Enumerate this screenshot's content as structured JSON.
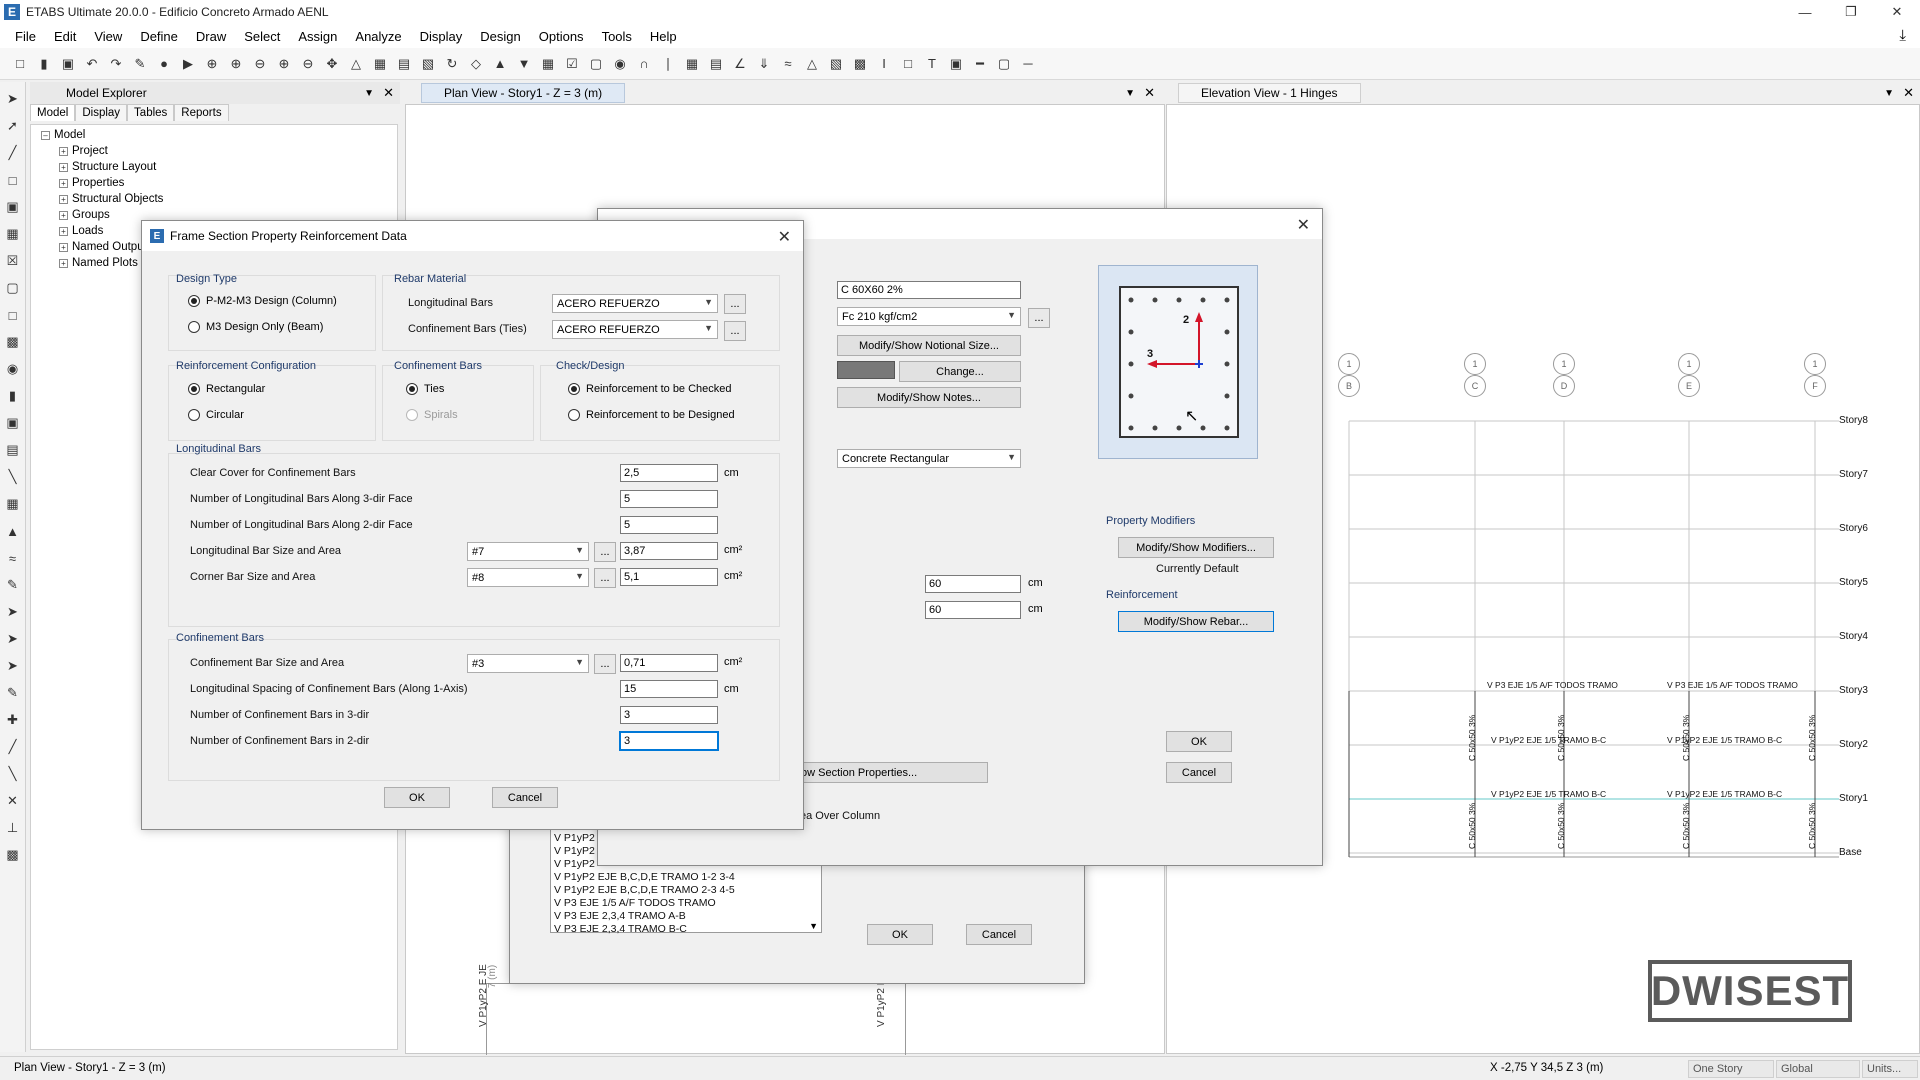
{
  "app": {
    "title": "ETABS Ultimate 20.0.0 - Edificio Concreto Armado AENL",
    "logo": "E",
    "accent": "#2b6cb0"
  },
  "menu": [
    "File",
    "Edit",
    "View",
    "Define",
    "Draw",
    "Select",
    "Assign",
    "Analyze",
    "Display",
    "Design",
    "Options",
    "Tools",
    "Help"
  ],
  "explorer": {
    "title": "Model Explorer",
    "tabs": [
      "Model",
      "Display",
      "Tables",
      "Reports"
    ],
    "root": "Model",
    "items": [
      "Project",
      "Structure Layout",
      "Properties",
      "Structural Objects",
      "Groups",
      "Loads",
      "Named Outputs",
      "Named Plots"
    ]
  },
  "plan_view": {
    "title": "Plan View - Story1 - Z = 3 (m)",
    "dim_label": "7 (m)",
    "beam_labels": [
      "V P1yP2 E JE",
      "V P1yP2 E JE B"
    ]
  },
  "elevation_view": {
    "title": "Elevation View - 1 Hinges",
    "axes": [
      "B",
      "C",
      "D",
      "E",
      "F"
    ],
    "axis_number": "1",
    "stories": [
      "Story8",
      "Story7",
      "Story6",
      "Story5",
      "Story4",
      "Story3",
      "Story2",
      "Story1",
      "Base"
    ],
    "beam_label_top": "V P3 EJE 1/5 A/F TODOS TRAMO",
    "beam_label_mid": "V P1yP2 EJE 1/5 TRAMO B-C",
    "column_label": "C 50x50 3%"
  },
  "rebar_dialog": {
    "title": "Frame Section Property Reinforcement Data",
    "design_type": {
      "title": "Design Type",
      "opt1": "P-M2-M3 Design  (Column)",
      "opt2": "M3 Design Only  (Beam)"
    },
    "rebar_material": {
      "title": "Rebar Material",
      "long_label": "Longitudinal Bars",
      "long_value": "ACERO REFUERZO",
      "conf_label": "Confinement Bars (Ties)",
      "conf_value": "ACERO REFUERZO"
    },
    "reinf_config": {
      "title": "Reinforcement Configuration",
      "opt1": "Rectangular",
      "opt2": "Circular"
    },
    "conf_bars_type": {
      "title": "Confinement Bars",
      "opt1": "Ties",
      "opt2": "Spirals"
    },
    "check_design": {
      "title": "Check/Design",
      "opt1": "Reinforcement to be Checked",
      "opt2": "Reinforcement to be Designed"
    },
    "longitudinal": {
      "title": "Longitudinal Bars",
      "cover_label": "Clear Cover for Confinement Bars",
      "cover_value": "2,5",
      "cover_unit": "cm",
      "n3_label": "Number of Longitudinal Bars Along 3-dir Face",
      "n3_value": "5",
      "n2_label": "Number of Longitudinal Bars Along 2-dir Face",
      "n2_value": "5",
      "size_label": "Longitudinal Bar Size and Area",
      "size_value": "#7",
      "area_value": "3,87",
      "area_unit": "cm²",
      "corner_label": "Corner Bar Size and Area",
      "corner_size": "#8",
      "corner_area": "5,1",
      "corner_unit": "cm²"
    },
    "confinement": {
      "title": "Confinement Bars",
      "size_label": "Confinement Bar Size and Area",
      "size_value": "#3",
      "area_value": "0,71",
      "area_unit": "cm²",
      "spacing_label": "Longitudinal Spacing of Confinement Bars  (Along 1-Axis)",
      "spacing_value": "15",
      "spacing_unit": "cm",
      "n3_label": "Number of Confinement Bars in 3-dir",
      "n3_value": "3",
      "n2_label": "Number of Confinement Bars in 2-dir",
      "n2_value": "3"
    },
    "ellipsis": "...",
    "ok": "OK",
    "cancel": "Cancel"
  },
  "section_dialog": {
    "name_value": "C 60X60 2%",
    "material_value": "Fc 210 kgf/cm2",
    "notional_btn": "Modify/Show Notional Size...",
    "change_btn": "Change...",
    "notes_btn": "Modify/Show Notes...",
    "shape_value": "Concrete Rectangular",
    "depth_value": "60",
    "width_value": "60",
    "unit": "cm",
    "show_section_btn": "ow Section Properties...",
    "area_over_col": "ea Over Column",
    "modifiers_title": "Property Modifiers",
    "modifiers_btn": "Modify/Show Modifiers...",
    "currently": "Currently Default",
    "reinforcement_title": "Reinforcement",
    "rebar_btn": "Modify/Show Rebar...",
    "axis2": "2",
    "axis3": "3",
    "color_swatch": "#787878",
    "ok": "OK",
    "cancel": "Cancel"
  },
  "frame_props_dialog": {
    "list": [
      "V P1yP2",
      "V P1yP2",
      "V P1yP2",
      "V P1yP2  EJE B,C,D,E TRAMO 1-2 3-4",
      "V P1yP2  EJE B,C,D,E TRAMO 2-3 4-5",
      "V P3 EJE 1/5 A/F TODOS TRAMO",
      "V P3 EJE 2,3,4 TRAMO A-B",
      "V P3 EJE 2,3,4 TRAMO B-C"
    ],
    "ok": "OK",
    "cancel": "Cancel"
  },
  "statusbar": {
    "left": "Plan View - Story1 - Z = 3 (m)",
    "coords": "X -2,75  Y 34,5  Z 3 (m)",
    "story_combo": "One Story",
    "global_combo": "Global",
    "units_btn": "Units..."
  },
  "watermark": "DWISEST"
}
